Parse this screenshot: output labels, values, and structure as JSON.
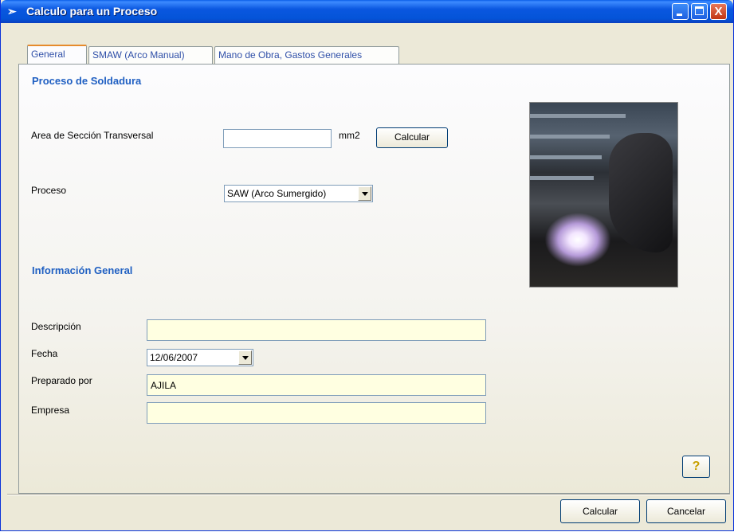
{
  "window": {
    "title": "Calculo para un Proceso",
    "close_glyph": "X"
  },
  "tabs": [
    {
      "label": "General",
      "active": true
    },
    {
      "label": "SMAW (Arco Manual)",
      "active": false
    },
    {
      "label": "Mano de Obra, Gastos Generales",
      "active": false
    }
  ],
  "proceso": {
    "section_title": "Proceso de Soldadura",
    "area_label": "Area de Sección Transversal",
    "area_value": "",
    "area_unit": "mm2",
    "calc_button": "Calcular",
    "proceso_label": "Proceso",
    "proceso_value": "SAW (Arco Sumergido)"
  },
  "info": {
    "section_title": "Información General",
    "descripcion_label": "Descripción",
    "descripcion_value": "",
    "fecha_label": "Fecha",
    "fecha_value": "12/06/2007",
    "preparado_label": "Preparado por",
    "preparado_value": "AJILA",
    "empresa_label": "Empresa",
    "empresa_value": ""
  },
  "footer": {
    "help_glyph": "?",
    "calcular": "Calcular",
    "cancelar": "Cancelar"
  },
  "icons": {
    "title": "app-icon",
    "help": "help-icon",
    "photo": "welding-photo"
  }
}
